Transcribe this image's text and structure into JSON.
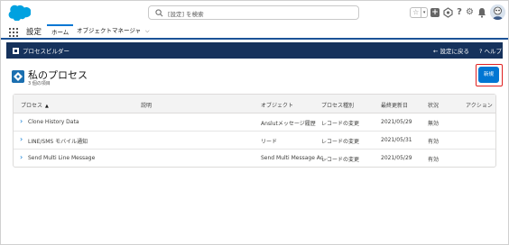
{
  "header": {
    "search_placeholder": "[設定] を検索",
    "fav_star": "☆",
    "fav_dropdown": "▾",
    "add_icon": "+",
    "help_icon": "?",
    "setup_icon": "⚙",
    "bell_icon": "🔔"
  },
  "context": {
    "app_name": "設定",
    "home_tab": "ホーム",
    "object_manager_tab": "オブジェクトマネージャ",
    "chevron": "⌵"
  },
  "process_builder": {
    "title": "プロセスビルダー",
    "back_label": "← 設定に戻る",
    "help_label": "? ヘルプ"
  },
  "page": {
    "title": "私のプロセス",
    "subtitle": "3 個の項目",
    "new_button": "新規"
  },
  "table": {
    "columns": [
      "プロセス",
      "説明",
      "オブジェクト",
      "プロセス種別",
      "最終更新日",
      "状況",
      "アクション"
    ],
    "sort_indicator": "▲",
    "rows": [
      {
        "expander": "›",
        "name": "Clone History Data",
        "description": "",
        "object": "Anslutメッセージ履歴",
        "type": "レコードの変更",
        "updated": "2021/05/29",
        "status": "無効",
        "action": ""
      },
      {
        "expander": "›",
        "name": "LINE/SMS モバイル通知",
        "description": "",
        "object": "リード",
        "type": "レコードの変更",
        "updated": "2021/05/31",
        "status": "有効",
        "action": ""
      },
      {
        "expander": "›",
        "name": "Send Multi Line Message",
        "description": "",
        "object": "Send Multi Message Ac...",
        "type": "レコードの変更",
        "updated": "2021/05/29",
        "status": "有効",
        "action": ""
      }
    ]
  },
  "colors": {
    "brand_blue": "#0176d3",
    "nav_dark": "#16325c",
    "highlight_red": "#e02020",
    "salesforce_cloud": "#00a1e0"
  }
}
